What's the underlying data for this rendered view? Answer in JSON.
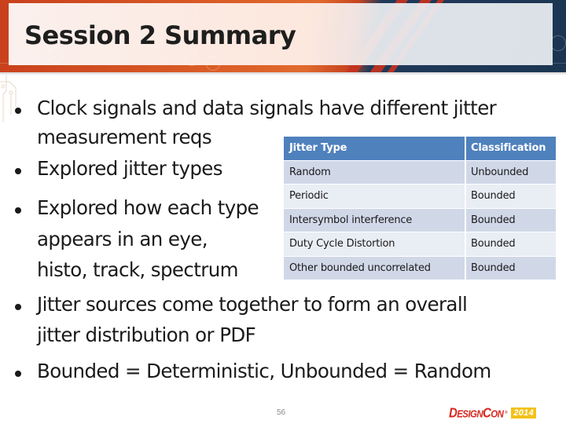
{
  "slide": {
    "title": "Session 2 Summary",
    "bullets": [
      {
        "lines": [
          "Clock signals and data signals have different jitter",
          "measurement reqs"
        ]
      },
      {
        "lines": [
          "Explored jitter types"
        ]
      },
      {
        "lines": [
          "Explored how each type",
          "appears in an eye,",
          "histo, track, spectrum"
        ]
      },
      {
        "lines": [
          "Jitter sources come together to form an overall",
          "jitter distribution or PDF"
        ]
      },
      {
        "lines": [
          "Bounded = Deterministic, Unbounded = Random"
        ]
      }
    ],
    "table": {
      "headers": [
        "Jitter Type",
        "Classification"
      ],
      "rows": [
        [
          "Random",
          "Unbounded"
        ],
        [
          "Periodic",
          "Bounded"
        ],
        [
          "Intersymbol interference",
          "Bounded"
        ],
        [
          "Duty Cycle Distortion",
          "Bounded"
        ],
        [
          "Other bounded uncorrelated",
          "Bounded"
        ]
      ]
    },
    "footer": {
      "page_number": "56",
      "logo": {
        "brand_big_1": "D",
        "brand_small_1": "ESIGN",
        "brand_big_2": "C",
        "brand_small_2": "ON",
        "year": "2014"
      }
    },
    "colors": {
      "table_header": "#4f81bd",
      "table_row_odd": "#d0d8e8",
      "table_row_even": "#e9edf4",
      "banner_orange": "#d95a25",
      "banner_navy": "#1b3552",
      "logo_red": "#d7281f",
      "logo_yellow": "#f2c21a"
    }
  }
}
